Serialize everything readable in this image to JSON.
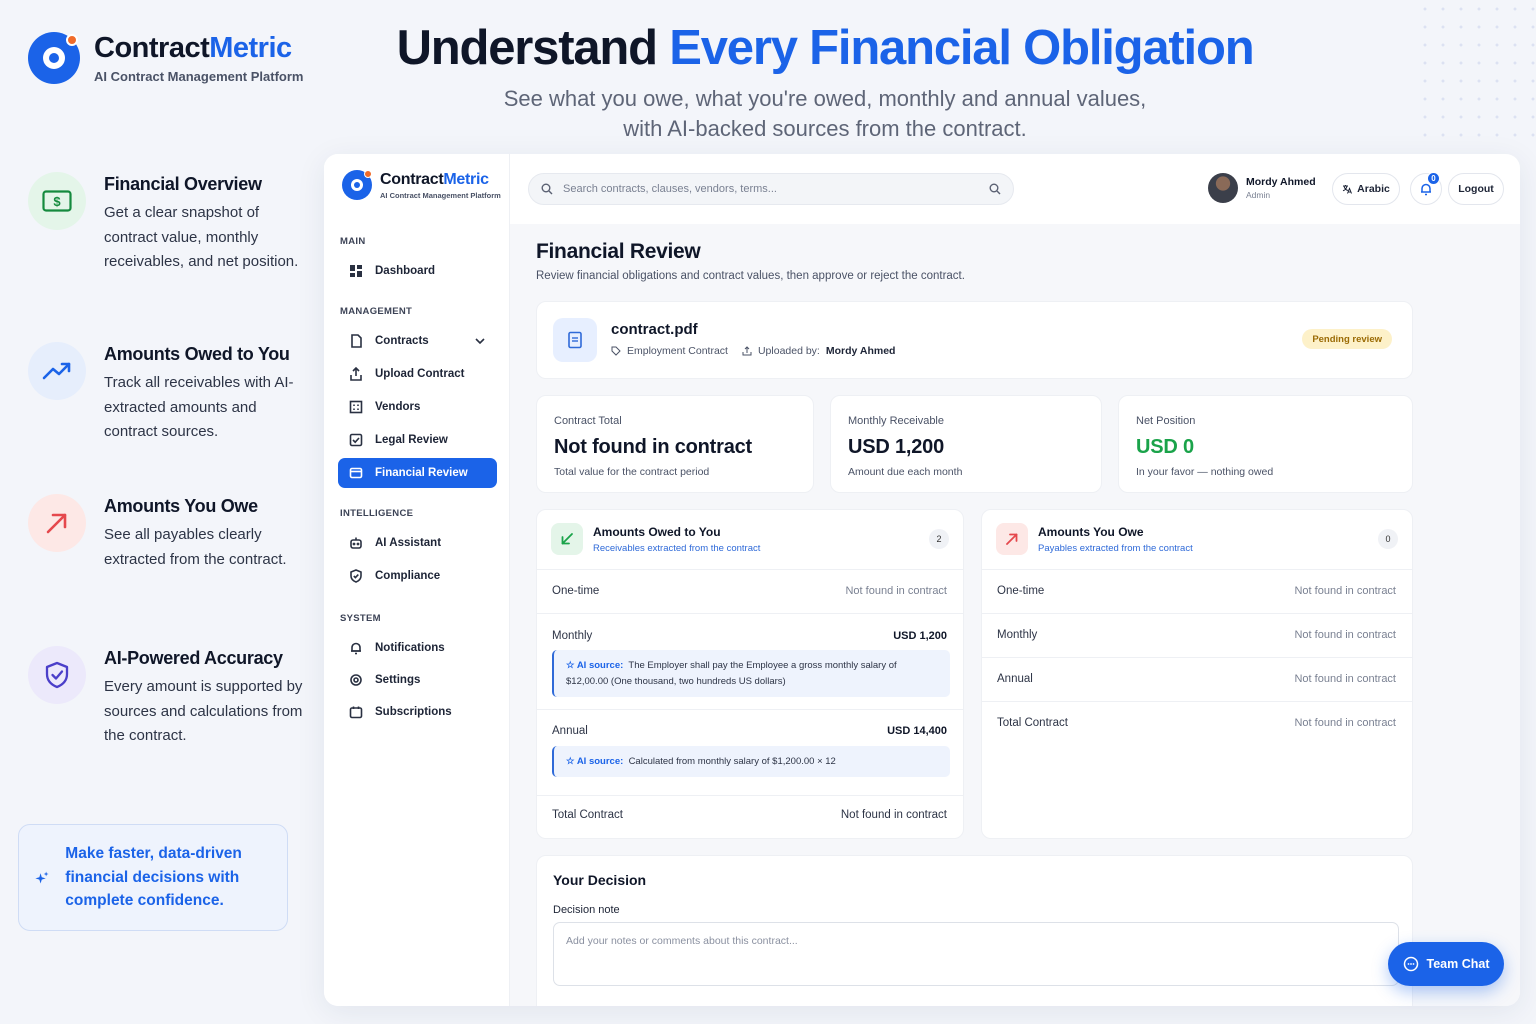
{
  "brand": {
    "name_a": "Contract",
    "name_b": "Metric",
    "subtitle": "AI Contract Management Platform"
  },
  "hero": {
    "title_a": "Understand ",
    "title_b": "Every Financial Obligation",
    "line1": "See what you owe, what you're owed, monthly and annual values,",
    "line2": "with AI-backed sources from the contract."
  },
  "features": [
    {
      "title": "Financial Overview",
      "desc": "Get a clear snapshot of contract value, monthly receivables, and net position.",
      "icon": "dollar-bill-icon"
    },
    {
      "title": "Amounts Owed to You",
      "desc": "Track all receivables with AI-extracted amounts and contract sources.",
      "icon": "trending-up-icon"
    },
    {
      "title": "Amounts You Owe",
      "desc": "See all payables clearly extracted from the contract.",
      "icon": "arrow-up-right-icon"
    },
    {
      "title": "AI-Powered Accuracy",
      "desc": "Every amount is supported by sources and calculations from the contract.",
      "icon": "shield-check-icon"
    }
  ],
  "callout": "Make faster, data-driven financial decisions with complete confidence.",
  "sidebar": {
    "brand_a": "Contract",
    "brand_b": "Metric",
    "brand_sub": "AI Contract Management Platform",
    "sections": {
      "main": "MAIN",
      "management": "MANAGEMENT",
      "intelligence": "INTELLIGENCE",
      "system": "SYSTEM"
    },
    "items": {
      "dashboard": "Dashboard",
      "contracts": "Contracts",
      "upload": "Upload Contract",
      "vendors": "Vendors",
      "legal": "Legal Review",
      "financial": "Financial Review",
      "assistant": "AI Assistant",
      "compliance": "Compliance",
      "notifications": "Notifications",
      "settings": "Settings",
      "subscriptions": "Subscriptions"
    }
  },
  "topbar": {
    "search_placeholder": "Search contracts, clauses, vendors, terms...",
    "user_name": "Mordy Ahmed",
    "user_role": "Admin",
    "language": "Arabic",
    "notif_count": "0",
    "logout": "Logout"
  },
  "page": {
    "title": "Financial Review",
    "subtitle": "Review financial obligations and contract values, then approve or reject the contract."
  },
  "file": {
    "name": "contract.pdf",
    "type": "Employment Contract",
    "uploaded_label": "Uploaded by:",
    "uploaded_by": "Mordy Ahmed",
    "status": "Pending review"
  },
  "stats": [
    {
      "label": "Contract Total",
      "value": "Not found in contract",
      "desc": "Total value for the contract period"
    },
    {
      "label": "Monthly Receivable",
      "value": "USD 1,200",
      "desc": "Amount due each month"
    },
    {
      "label": "Net Position",
      "value": "USD 0",
      "desc": "In your favor — nothing owed"
    }
  ],
  "owed_to_you": {
    "title": "Amounts Owed to You",
    "subtitle": "Receivables extracted from the contract",
    "count": "2",
    "rows": {
      "onetime": {
        "label": "One-time",
        "value": "Not found in contract"
      },
      "monthly": {
        "label": "Monthly",
        "value": "USD 1,200"
      },
      "annual": {
        "label": "Annual",
        "value": "USD 14,400"
      },
      "total": {
        "label": "Total Contract",
        "value": "Not found in contract"
      }
    },
    "ai_label": "AI source:",
    "monthly_source": "The Employer shall pay the Employee a gross monthly salary of $12,00.00 (One thousand, two hundreds US dollars)",
    "annual_source": "Calculated from monthly salary of $1,200.00 × 12"
  },
  "you_owe": {
    "title": "Amounts You Owe",
    "subtitle": "Payables extracted from the contract",
    "count": "0",
    "rows": {
      "onetime": {
        "label": "One-time",
        "value": "Not found in contract"
      },
      "monthly": {
        "label": "Monthly",
        "value": "Not found in contract"
      },
      "annual": {
        "label": "Annual",
        "value": "Not found in contract"
      },
      "total": {
        "label": "Total Contract",
        "value": "Not found in contract"
      }
    }
  },
  "decision": {
    "title": "Your Decision",
    "note_label": "Decision note",
    "note_placeholder": "Add your notes or comments about this contract..."
  },
  "team_chat": "Team Chat",
  "colors": {
    "accent": "#1b63e8",
    "success": "#1aa34a",
    "danger": "#e5484d",
    "warning_bg": "#fdf1c9"
  }
}
